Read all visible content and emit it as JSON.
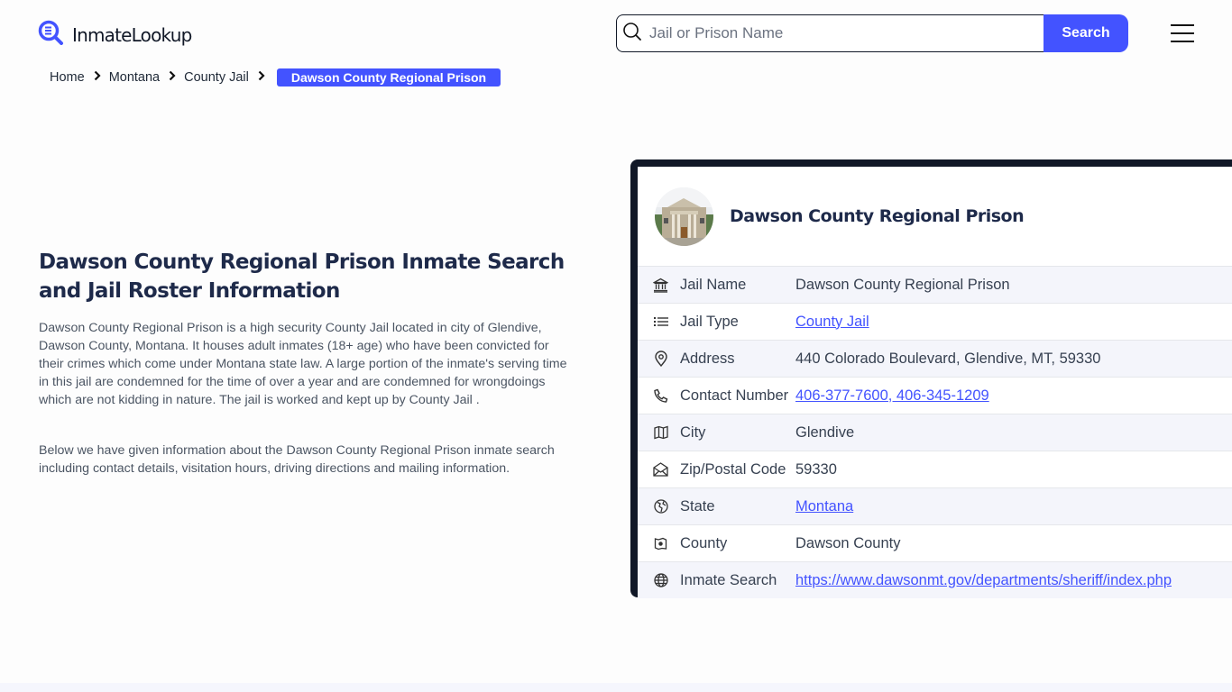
{
  "header": {
    "logo_text": "InmateLookup",
    "search_placeholder": "Jail or Prison Name",
    "search_value": "",
    "search_button": "Search"
  },
  "breadcrumb": {
    "items": [
      "Home",
      "Montana",
      "County Jail"
    ],
    "current": "Dawson County Regional Prison"
  },
  "main": {
    "title": "Dawson County Regional Prison Inmate Search and Jail Roster Information",
    "paragraphs": [
      "Dawson County Regional Prison is a high security County Jail located in city of Glendive, Dawson County, Montana. It houses adult inmates (18+ age) who have been convicted for their crimes which come under Montana state law. A large portion of the inmate's serving time in this jail are condemned for the time of over a year and are condemned for wrongdoings which are not kidding in nature. The jail is worked and kept up by County Jail .",
      "Below we have given information about the Dawson County Regional Prison inmate search including contact details, visitation hours, driving directions and mailing information."
    ]
  },
  "card": {
    "title": "Dawson County Regional Prison",
    "rows": [
      {
        "icon": "bank-icon",
        "label": "Jail Name",
        "value": "Dawson County Regional Prison",
        "link": false
      },
      {
        "icon": "list-icon",
        "label": "Jail Type",
        "value": "County Jail",
        "link": true
      },
      {
        "icon": "map-pin-icon",
        "label": "Address",
        "value": "440 Colorado Boulevard, Glendive, MT, 59330",
        "link": false
      },
      {
        "icon": "phone-icon",
        "label": "Contact Number",
        "value": "406-377-7600, 406-345-1209",
        "link": true
      },
      {
        "icon": "map-icon",
        "label": "City",
        "value": "Glendive",
        "link": false
      },
      {
        "icon": "mail-open-icon",
        "label": "Zip/Postal Code",
        "value": "59330",
        "link": false
      },
      {
        "icon": "globe-region-icon",
        "label": "State",
        "value": "Montana",
        "link": true
      },
      {
        "icon": "county-icon",
        "label": "County",
        "value": "Dawson County",
        "link": false
      },
      {
        "icon": "globe-icon",
        "label": "Inmate Search",
        "value": "https://www.dawsonmt.gov/departments/sheriff/index.php",
        "link": true
      }
    ]
  },
  "colors": {
    "accent": "#4353ff",
    "title": "#1e2a4a",
    "card_border": "#111827",
    "row_alt": "#f4f5fb"
  }
}
